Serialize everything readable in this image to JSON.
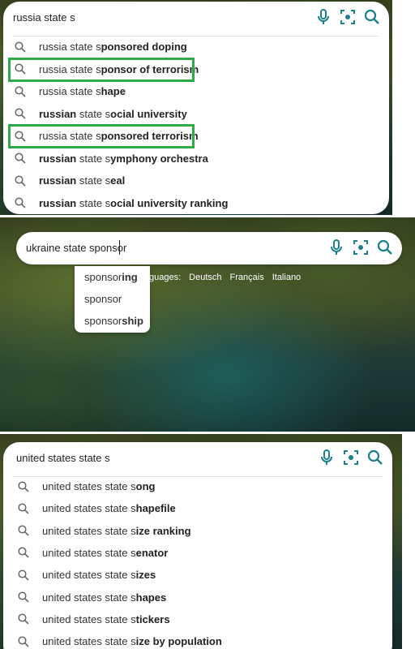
{
  "colors": {
    "accent": "#1b7f8c",
    "highlight": "#2eaa48"
  },
  "icons": {
    "mic": "microphone-icon",
    "lens": "visual-search-icon",
    "search": "search-icon",
    "suggestion": "magnifier-icon"
  },
  "panel1": {
    "query": "russia state s",
    "suggestions": [
      {
        "pre": "russia state s",
        "bold": "ponsored doping",
        "highlighted": false
      },
      {
        "pre": "russia state s",
        "bold": "ponsor of terrorism",
        "highlighted": true
      },
      {
        "pre": "russia state s",
        "bold": "hape",
        "highlighted": false
      },
      {
        "pre": "",
        "bold": "russian",
        "post": " state s",
        "bold2": "ocial university",
        "highlighted": false
      },
      {
        "pre": "russia state s",
        "bold": "ponsored terrorism",
        "highlighted": true
      },
      {
        "pre": "",
        "bold": "russian",
        "post": " state s",
        "bold2": "ymphony orchestra",
        "highlighted": false
      },
      {
        "pre": "",
        "bold": "russian",
        "post": " state s",
        "bold2": "eal",
        "highlighted": false
      },
      {
        "pre": "",
        "bold": "russian",
        "post": " state s",
        "bold2": "ocial university ranking",
        "highlighted": false
      }
    ]
  },
  "panel2": {
    "query": "ukraine state sponsor",
    "suggestions": [
      {
        "pre": "sponsor",
        "bold": "ing"
      },
      {
        "pre": "sponsor",
        "bold": ""
      },
      {
        "pre": "sponsor",
        "bold": "ship"
      }
    ],
    "languages_label": "guages:",
    "languages": [
      "Deutsch",
      "Français",
      "Italiano"
    ]
  },
  "panel3": {
    "query": "united states state s",
    "suggestions": [
      {
        "pre": "united states state s",
        "bold": "ong"
      },
      {
        "pre": "united states state s",
        "bold": "hapefile"
      },
      {
        "pre": "united states state s",
        "bold": "ize ranking"
      },
      {
        "pre": "united states state s",
        "bold": "enator"
      },
      {
        "pre": "united states state s",
        "bold": "izes"
      },
      {
        "pre": "united states state s",
        "bold": "hapes"
      },
      {
        "pre": "united states state s",
        "bold": "tickers"
      },
      {
        "pre": "united states state s",
        "bold": "ize by population"
      }
    ]
  }
}
